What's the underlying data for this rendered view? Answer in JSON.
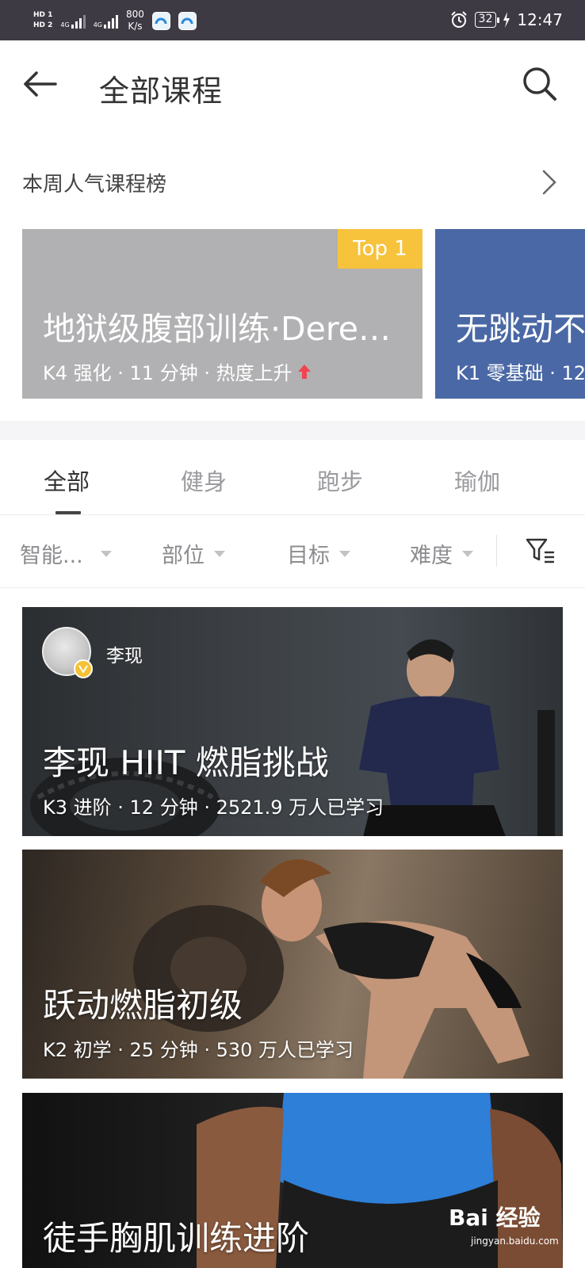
{
  "status_bar": {
    "hd_top": "HD 1",
    "hd_bottom": "HD 2",
    "sig1_label": "4G",
    "sig2_label": "4G",
    "net_speed_value": "800",
    "net_speed_unit": "K/s",
    "battery": "32",
    "time": "12:47",
    "icons": [
      "alarm-icon",
      "battery-icon",
      "charging-icon"
    ]
  },
  "header": {
    "title": "全部课程",
    "back_icon": "arrow-left-icon",
    "search_icon": "search-icon"
  },
  "popular": {
    "title": "本周人气课程榜",
    "cards": [
      {
        "badge": "Top 1",
        "title": "地狱级腹部训练·Derek初级",
        "meta": "K4 强化 · 11 分钟 · 热度上升",
        "color": "#b1b1b3"
      },
      {
        "title": "无跳动不扰邻",
        "meta": "K1 零基础 · 12",
        "color": "#4a68a5"
      }
    ]
  },
  "tabs": [
    {
      "label": "全部",
      "active": true
    },
    {
      "label": "健身",
      "active": false
    },
    {
      "label": "跑步",
      "active": false
    },
    {
      "label": "瑜伽",
      "active": false
    }
  ],
  "filters": {
    "items": [
      "智能...",
      "部位",
      "目标",
      "难度"
    ],
    "icon": "filter-icon"
  },
  "courses": [
    {
      "coach": "李现",
      "title": "李现 HIIT 燃脂挑战",
      "meta": "K3 进阶 · 12 分钟 · 2521.9 万人已学习"
    },
    {
      "title": "跃动燃脂初级",
      "meta": "K2 初学 · 25 分钟 · 530 万人已学习"
    },
    {
      "title": "徒手胸肌训练进阶"
    }
  ],
  "watermark": {
    "main": "Bai 经验",
    "sub": "jingyan.baidu.com"
  },
  "colors": {
    "status_bar": "#3d3a44",
    "badge": "#f7c23c",
    "hot_arrow": "#f0454f"
  }
}
